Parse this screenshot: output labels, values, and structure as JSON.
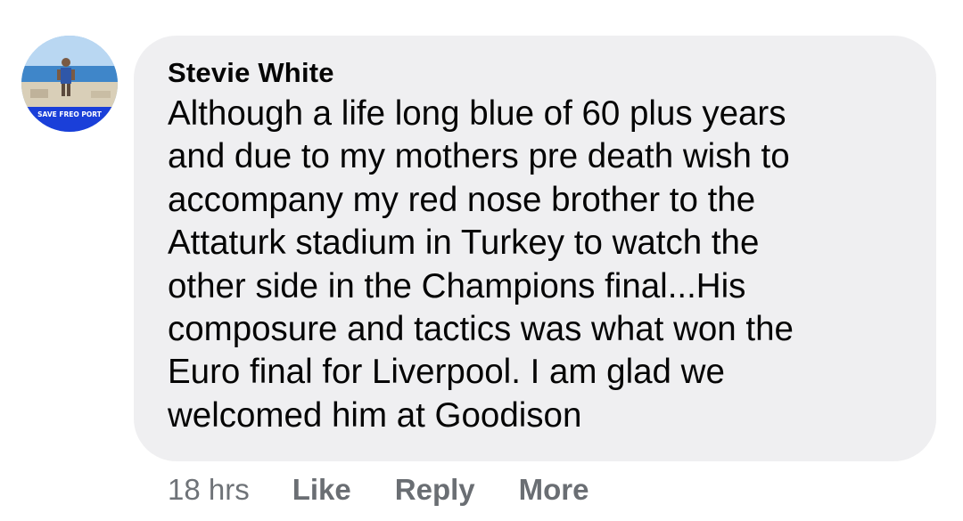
{
  "comment": {
    "avatar": {
      "badge_text": "SAVE FREO PORT"
    },
    "author": "Stevie White",
    "text": "Although a life long blue of 60 plus years\nand due to my mothers pre death wish to\naccompany my red nose brother to the\nAttaturk stadium in Turkey to watch the\nother side in the Champions final...His\ncomposure and tactics was what won the\nEuro final for Liverpool. I am glad we\nwelcomed him at Goodison",
    "timestamp": "18 hrs",
    "actions": {
      "like": "Like",
      "reply": "Reply",
      "more": "More"
    }
  },
  "colors": {
    "bubble_background": "#efeff1",
    "text": "#050505",
    "meta": "#6f7378",
    "badge_blue": "#1a3fd9"
  }
}
